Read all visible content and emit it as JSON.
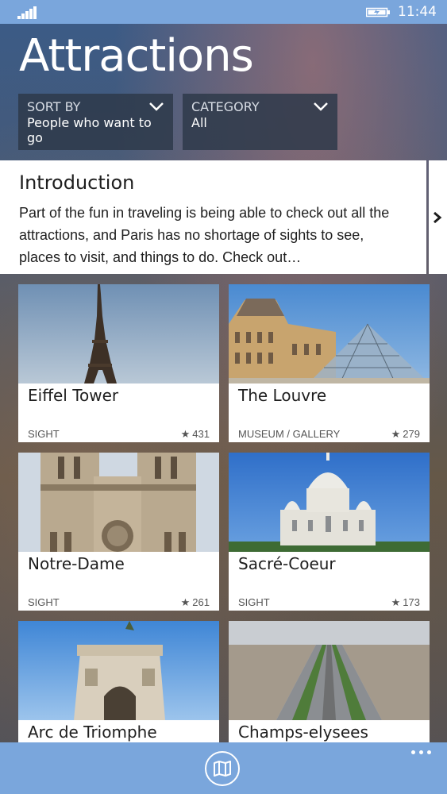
{
  "status_bar": {
    "time": "11:44",
    "signal_icon": "signal-icon",
    "battery_icon": "battery-charging-icon"
  },
  "header": {
    "title": "Attractions"
  },
  "filters": {
    "sort": {
      "label": "SORT BY",
      "value": "People who want to go"
    },
    "category": {
      "label": "CATEGORY",
      "value": "All"
    }
  },
  "intro": {
    "title": "Introduction",
    "text": "Part of the fun in traveling is being able to check out all the attractions, and Paris has no shortage of sights to see, places to visit, and things to do. Check out…"
  },
  "attractions": [
    {
      "name": "Eiffel Tower",
      "type": "SIGHT",
      "rating": "431"
    },
    {
      "name": "The Louvre",
      "type": "MUSEUM / GALLERY",
      "rating": "279"
    },
    {
      "name": "Notre-Dame",
      "type": "SIGHT",
      "rating": "261"
    },
    {
      "name": "Sacré-Coeur",
      "type": "SIGHT",
      "rating": "173"
    },
    {
      "name": "Arc de Triomphe",
      "type": "",
      "rating": ""
    },
    {
      "name": "Champs-elysees",
      "type": "",
      "rating": ""
    }
  ],
  "star_glyph": "★",
  "app_bar": {
    "map_icon": "map-icon",
    "more_icon": "more-icon"
  },
  "colors": {
    "accent": "#7aa6dc"
  }
}
